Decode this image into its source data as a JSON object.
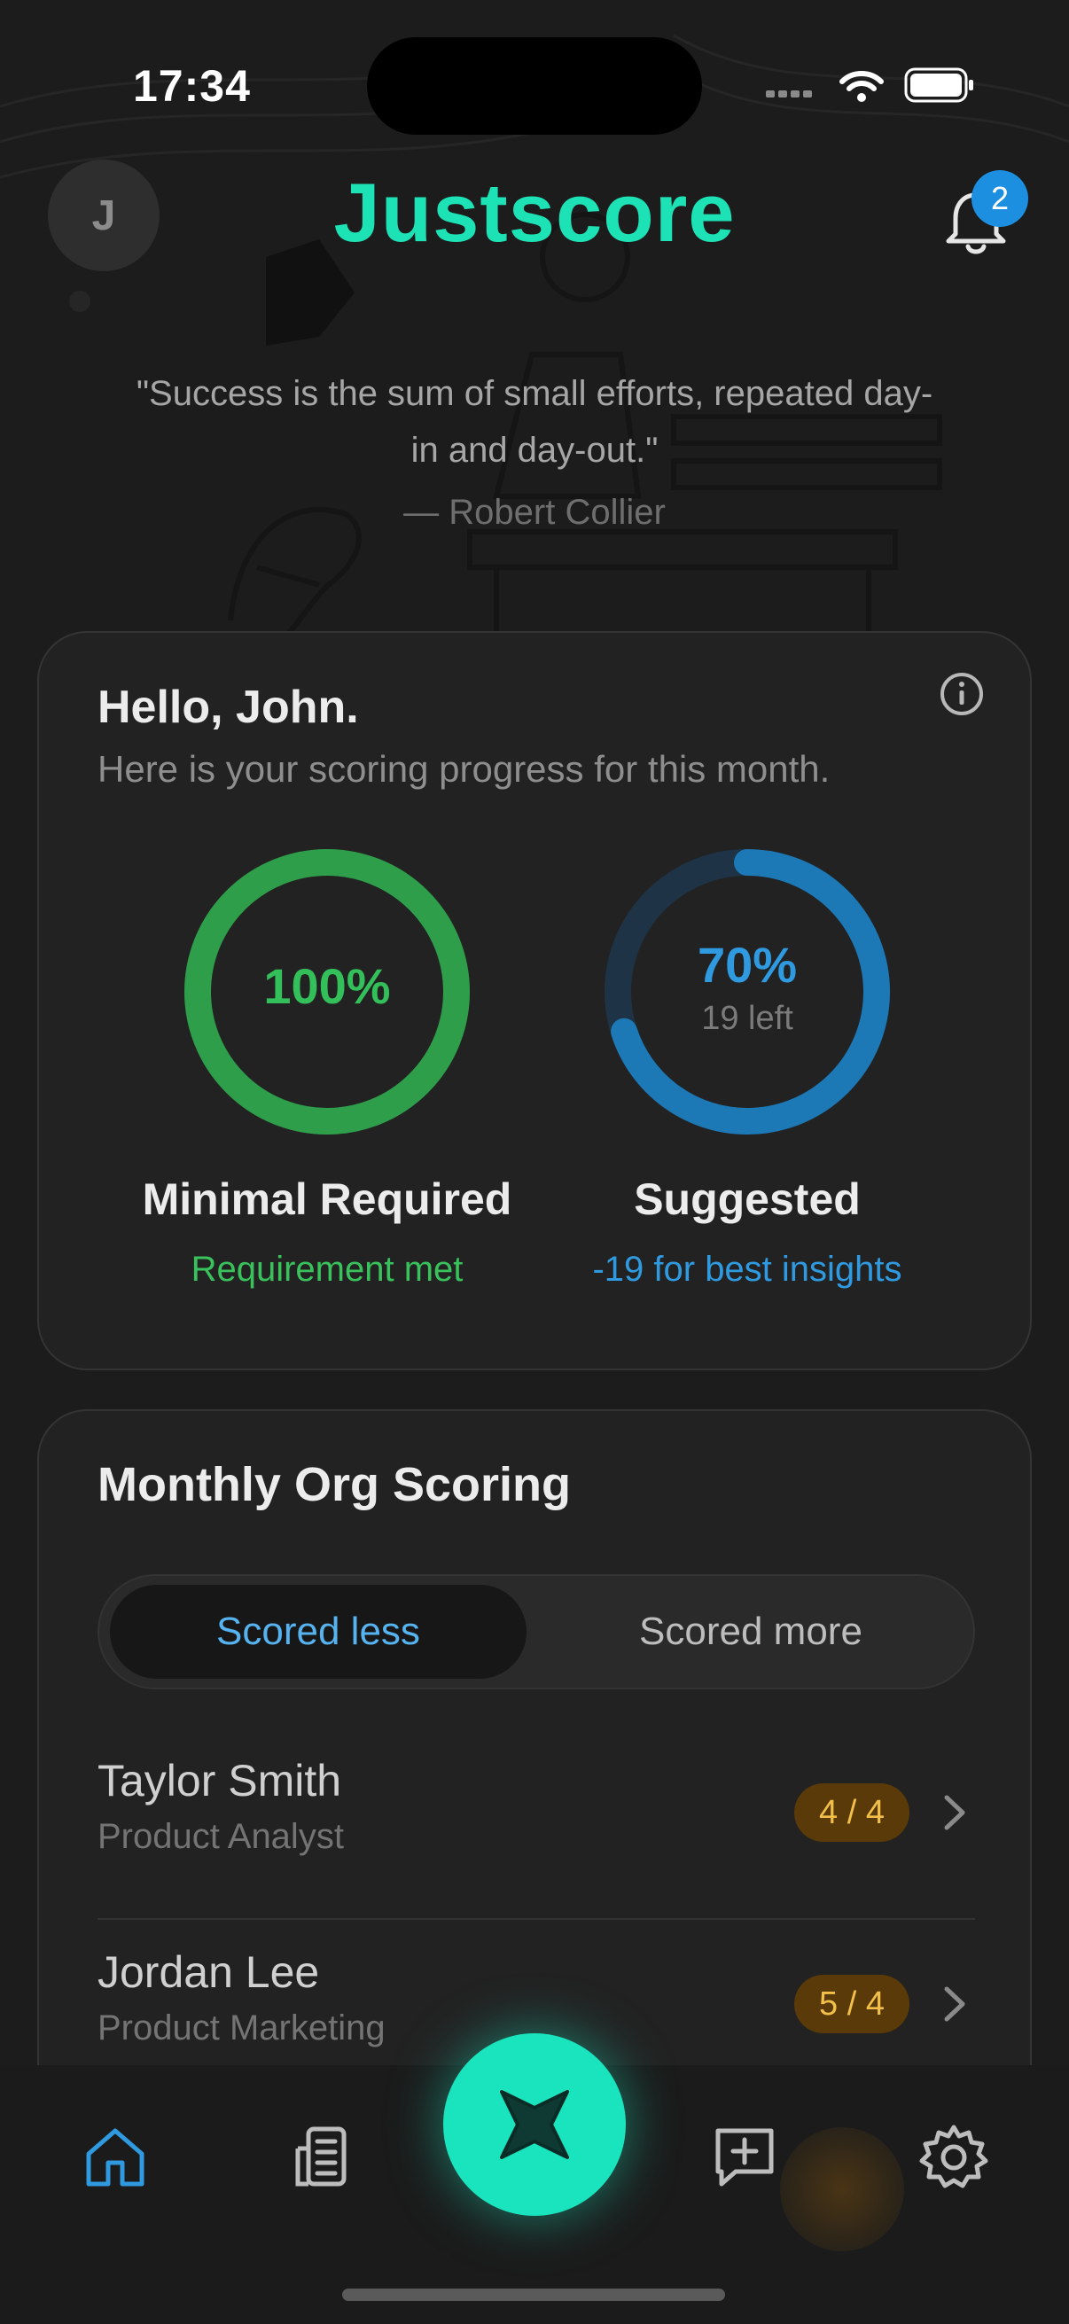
{
  "status_bar": {
    "time": "17:34"
  },
  "header": {
    "avatar_initial": "J",
    "app_name": "Justscore",
    "notification_count": "2"
  },
  "quote": {
    "text": "\"Success is the sum of small efforts, repeated day-in and day-out.\"",
    "author": "— Robert Collier"
  },
  "progress_card": {
    "greeting": "Hello, John.",
    "subtitle": "Here is your scoring progress for this month.",
    "minimal": {
      "value_text": "100%",
      "progress": 1.0,
      "title": "Minimal Required",
      "note": "Requirement met",
      "color": "#33c05a"
    },
    "suggested": {
      "value_text": "70%",
      "progress": 0.7,
      "remaining": "19 left",
      "title": "Suggested",
      "note": "-19 for best insights",
      "color": "#2f9ae0"
    }
  },
  "org_scoring": {
    "title": "Monthly Org Scoring",
    "tabs": [
      "Scored less",
      "Scored more"
    ],
    "active_tab": "Scored less",
    "items": [
      {
        "name": "Taylor Smith",
        "role": "Product Analyst",
        "score": "4 / 4"
      },
      {
        "name": "Jordan Lee",
        "role": "Product Marketing",
        "score": "5 / 4"
      }
    ]
  },
  "tabbar": {
    "items": [
      "home-icon",
      "document-icon",
      "sparkle-icon",
      "message-plus-icon",
      "gear-icon"
    ],
    "active": "home-icon",
    "accent": "#19e4bd"
  }
}
